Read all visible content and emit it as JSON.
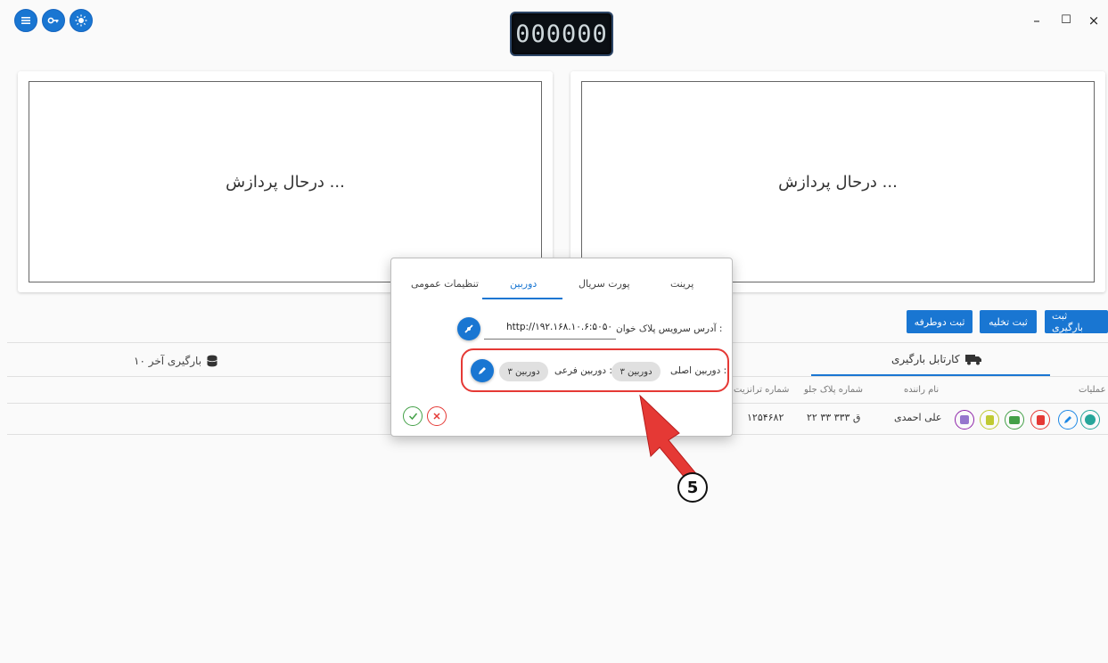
{
  "display": {
    "plate_counter": "000000"
  },
  "window": {
    "minimize_glyph": "–",
    "maximize_glyph": "☐",
    "close_glyph": "×"
  },
  "toolbar": {
    "icons": [
      "menu-icon",
      "key-icon",
      "brightness-icon"
    ]
  },
  "video": {
    "left_status": "درحال پردازش ...",
    "right_status": "درحال پردازش ..."
  },
  "actions": {
    "loading": "ثبت بارگیری",
    "unloading": "ثبت تخلیه",
    "two_way": "ثبت دوطرفه"
  },
  "cartable": {
    "tab_label": "کارتابل بارگیری",
    "recent_label": "۱۰ بارگیری آخر"
  },
  "table": {
    "headers": {
      "operations": "عملیات",
      "driver": "نام راننده",
      "front_plate": "شماره پلاک جلو",
      "transit": "شماره ترانزیت"
    },
    "row": {
      "driver": "علی احمدی",
      "front_plate": "۲۲ ق ۳۳۳ ۳۳",
      "transit": "۱۲۵۴۶۸۲"
    }
  },
  "dialog": {
    "tabs": {
      "print": "پرینت",
      "serial": "پورت سریال",
      "camera": "دوربین",
      "general": "تنظیمات عمومی"
    },
    "service_label": "آدرس سرویس پلاک خوان :",
    "service_value": "http://۱۹۲.۱۶۸.۱۰.۶:۵۰۵۰",
    "main_camera_label": "دوربین اصلی :",
    "main_camera_value": "دوربین ۳",
    "sub_camera_label": "دوربین فرعی :",
    "sub_camera_value": "دوربین ۳"
  },
  "annotation": {
    "step_number": "5"
  },
  "colors": {
    "primary": "#1976d2",
    "highlight": "#e53935",
    "confirm": "#43a047",
    "cancel": "#e53935"
  }
}
